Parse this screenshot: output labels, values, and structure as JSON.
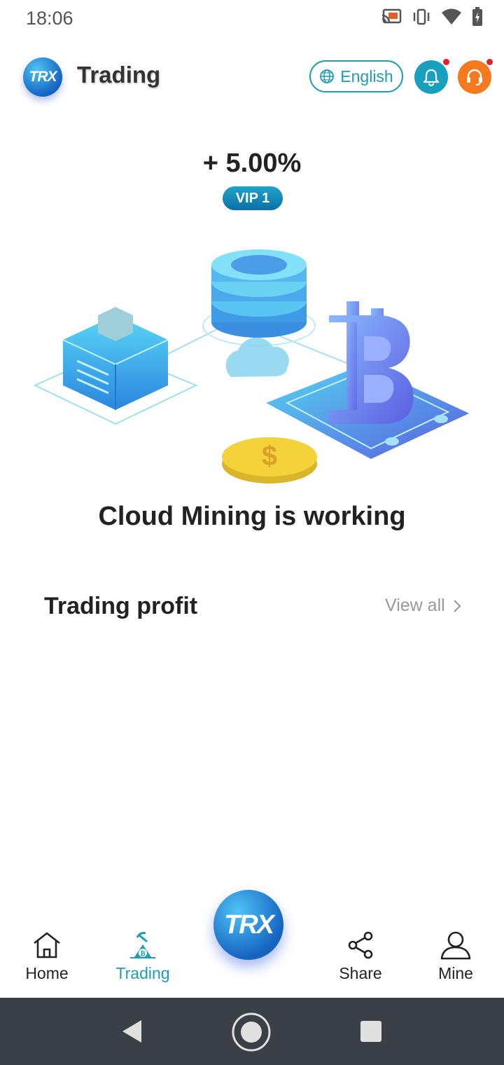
{
  "status_bar": {
    "time": "18:06"
  },
  "header": {
    "logo_text": "TRX",
    "title": "Trading",
    "language_label": "English"
  },
  "rate": {
    "value": "+ 5.00%",
    "vip_label": "VIP 1"
  },
  "illustration": {
    "coin_symbol": "$"
  },
  "status_message": "Cloud Mining is working",
  "profit_section": {
    "title": "Trading profit",
    "view_all_label": "View all"
  },
  "bottom_nav": {
    "center_logo_text": "TRX",
    "items": [
      {
        "label": "Home",
        "icon": "home-icon"
      },
      {
        "label": "Trading",
        "icon": "trading-icon"
      },
      {
        "label": "Share",
        "icon": "share-icon"
      },
      {
        "label": "Mine",
        "icon": "user-icon"
      }
    ],
    "active_item": "Trading"
  },
  "colors": {
    "accent": "#1e9db5",
    "support": "#f4791f",
    "notification_dot": "#e6202a",
    "system_nav": "#3b4047"
  }
}
